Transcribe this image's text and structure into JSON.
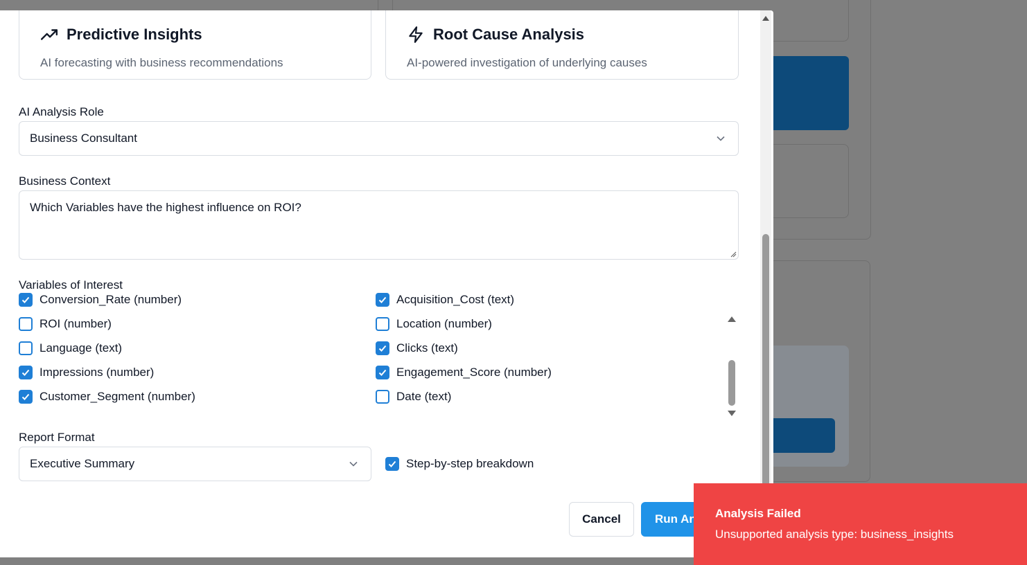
{
  "analysis_types": [
    {
      "title": "Predictive Insights",
      "description": "AI forecasting with business recommendations",
      "icon": "trending-up-icon"
    },
    {
      "title": "Root Cause Analysis",
      "description": "AI-powered investigation of underlying causes",
      "icon": "lightning-icon"
    }
  ],
  "ai_role": {
    "label": "AI Analysis Role",
    "value": "Business Consultant"
  },
  "business_context": {
    "label": "Business Context",
    "value": "Which Variables have the highest influence on ROI?"
  },
  "variables": {
    "label": "Variables of Interest",
    "items": [
      {
        "label": "Conversion_Rate (number)",
        "checked": true
      },
      {
        "label": "Acquisition_Cost (text)",
        "checked": true
      },
      {
        "label": "ROI (number)",
        "checked": false
      },
      {
        "label": "Location (number)",
        "checked": false
      },
      {
        "label": "Language (text)",
        "checked": false
      },
      {
        "label": "Clicks (text)",
        "checked": true
      },
      {
        "label": "Impressions (number)",
        "checked": true
      },
      {
        "label": "Engagement_Score (number)",
        "checked": true
      },
      {
        "label": "Customer_Segment (number)",
        "checked": true
      },
      {
        "label": "Date (text)",
        "checked": false
      }
    ]
  },
  "report_format": {
    "label": "Report Format",
    "value": "Executive Summary"
  },
  "step_by_step": {
    "label": "Step-by-step breakdown",
    "checked": true
  },
  "actions": {
    "cancel": "Cancel",
    "run": "Run Analysis"
  },
  "toast": {
    "title": "Analysis Failed",
    "message": "Unsupported analysis type: business_insights",
    "color": "#ef4444"
  },
  "colors": {
    "accent": "#2093e8",
    "checkbox": "#1f7fd6"
  }
}
